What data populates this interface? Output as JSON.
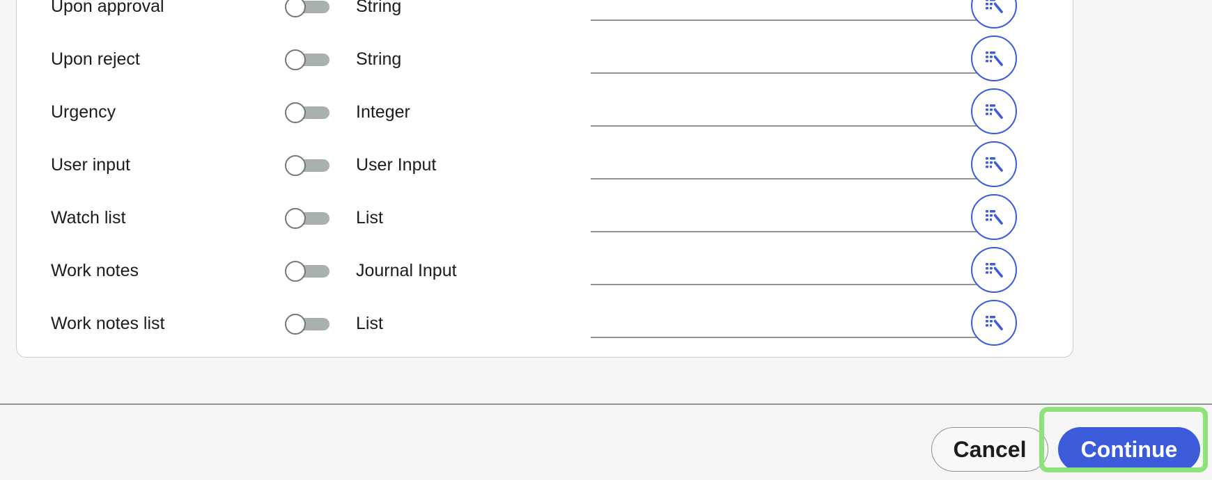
{
  "fields": [
    {
      "name": "Upon approval",
      "type": "String",
      "value": "",
      "enabled": false
    },
    {
      "name": "Upon reject",
      "type": "String",
      "value": "",
      "enabled": false
    },
    {
      "name": "Urgency",
      "type": "Integer",
      "value": "",
      "enabled": false
    },
    {
      "name": "User input",
      "type": "User Input",
      "value": "",
      "enabled": false
    },
    {
      "name": "Watch list",
      "type": "List",
      "value": "",
      "enabled": false
    },
    {
      "name": "Work notes",
      "type": "Journal Input",
      "value": "",
      "enabled": false
    },
    {
      "name": "Work notes list",
      "type": "List",
      "value": "",
      "enabled": false
    }
  ],
  "footer": {
    "cancel_label": "Cancel",
    "continue_label": "Continue"
  },
  "icons": {
    "row_action": "data-pill-picker-icon"
  },
  "colors": {
    "primary": "#3b5bdb",
    "focus_highlight": "#8ee27a",
    "toggle_off": "#a9b0b0"
  }
}
